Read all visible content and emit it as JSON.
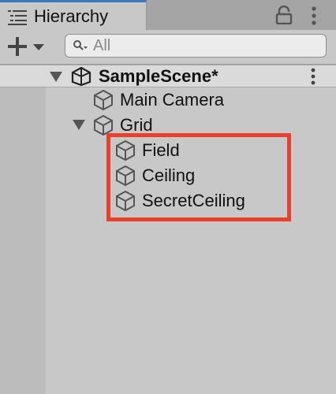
{
  "panel": {
    "tab_title": "Hierarchy",
    "tab_icon": "hierarchy-list-icon",
    "lock_icon": "lock-icon",
    "menu_icon": "kebab-menu-icon"
  },
  "toolbar": {
    "add_icon": "plus-icon",
    "dropdown_icon": "dropdown-arrow-icon",
    "search_icon": "search-icon",
    "search_placeholder": "All",
    "search_value": ""
  },
  "scene": {
    "name": "SampleScene*",
    "icon": "unity-logo-icon",
    "expanded": true
  },
  "items": [
    {
      "label": "Main Camera",
      "icon": "gameobject-cube-icon",
      "depth": 1
    },
    {
      "label": "Grid",
      "icon": "gameobject-cube-icon",
      "depth": 1,
      "expanded": true
    },
    {
      "label": "Field",
      "icon": "gameobject-cube-icon",
      "depth": 2
    },
    {
      "label": "Ceiling",
      "icon": "gameobject-cube-icon",
      "depth": 2
    },
    {
      "label": "SecretCeiling",
      "icon": "gameobject-cube-icon",
      "depth": 2
    }
  ],
  "colors": {
    "highlight": "#ea3f2d",
    "panel_background": "#c8c8c8",
    "tab_accent": "#3a79bb",
    "scene_row": "#dadada"
  }
}
